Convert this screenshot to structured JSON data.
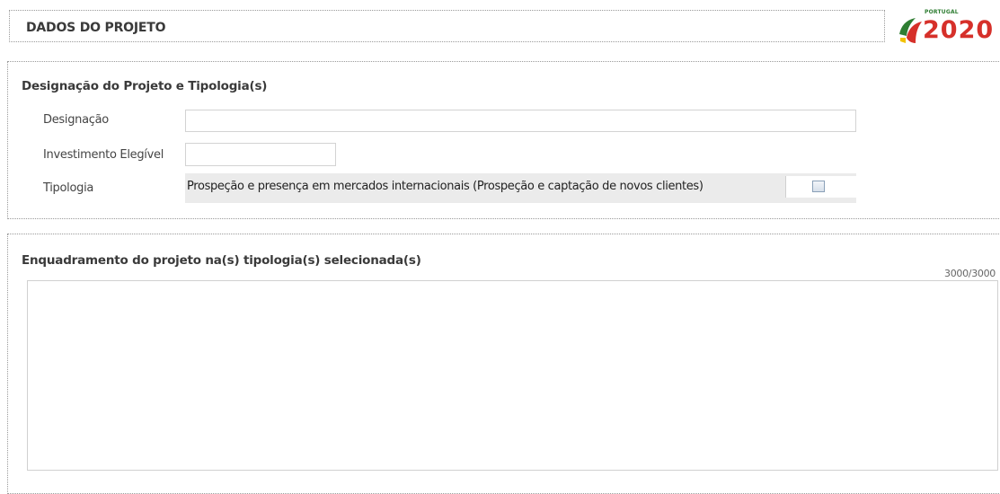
{
  "header": {
    "title": "DADOS DO PROJETO",
    "logo": {
      "small_text": "PORTUGAL",
      "year_text": "2020"
    }
  },
  "section_designacao": {
    "title": "Designação do Projeto e Tipologia(s)",
    "fields": {
      "designacao": {
        "label": "Designação",
        "value": ""
      },
      "investimento": {
        "label": "Investimento Elegível",
        "value": ""
      },
      "tipologia": {
        "label": "Tipologia",
        "option_text": "Prospeção e presença em mercados internacionais (Prospeção e captação de novos clientes)",
        "checked": false
      }
    }
  },
  "section_enquadramento": {
    "title": "Enquadramento do projeto na(s) tipologia(s) selecionada(s)",
    "counter": "3000/3000",
    "value": ""
  },
  "colors": {
    "border": "#9a9a9a",
    "logo_green": "#2e7d32",
    "logo_red": "#d6302a",
    "tipologia_bg": "#ebebeb"
  }
}
